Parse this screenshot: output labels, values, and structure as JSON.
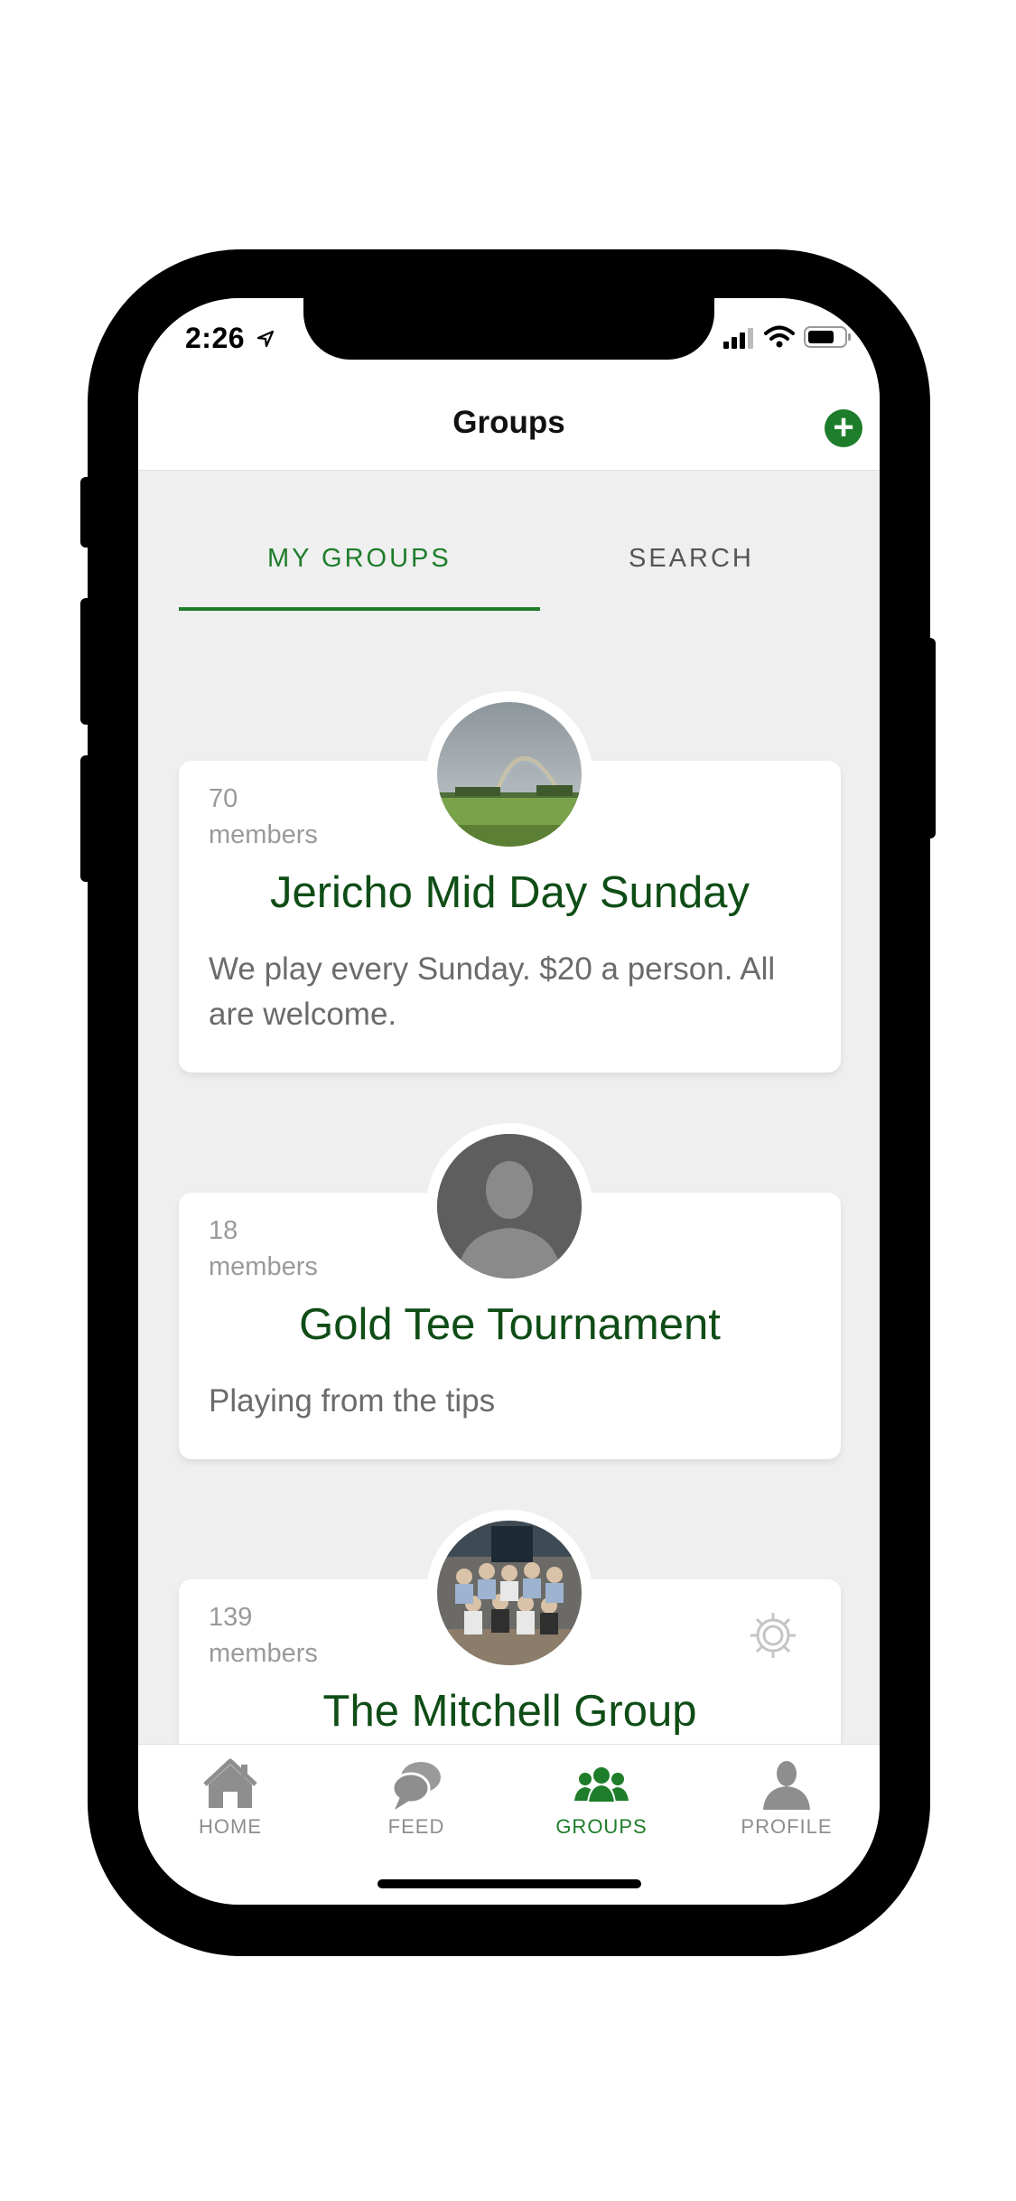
{
  "status_bar": {
    "time": "2:26"
  },
  "navbar": {
    "title": "Groups",
    "add_label": "+"
  },
  "tabs": [
    {
      "label": "MY GROUPS",
      "active": true
    },
    {
      "label": "SEARCH",
      "active": false
    }
  ],
  "groups": [
    {
      "members_count": "70",
      "members_label": "members",
      "name": "Jericho Mid Day Sunday",
      "description": "We play every Sunday. $20 a person. All are welcome.",
      "avatar": "rainbow-field-photo",
      "has_settings": false
    },
    {
      "members_count": "18",
      "members_label": "members",
      "name": "Gold Tee Tournament",
      "description": "Playing from the tips",
      "avatar": "default-person-icon",
      "has_settings": false
    },
    {
      "members_count": "139",
      "members_label": "members",
      "name": "The Mitchell Group",
      "description": "",
      "avatar": "group-people-photo",
      "has_settings": true
    }
  ],
  "tab_bar": [
    {
      "label": "HOME",
      "icon": "home-icon",
      "active": false
    },
    {
      "label": "FEED",
      "icon": "chat-bubbles-icon",
      "active": false
    },
    {
      "label": "GROUPS",
      "icon": "groups-icon",
      "active": true
    },
    {
      "label": "PROFILE",
      "icon": "profile-icon",
      "active": false
    }
  ],
  "colors": {
    "accent": "#1e7d2a",
    "group_name": "#0f4d16",
    "inactive": "#8e8e8e",
    "background": "#efefef"
  }
}
